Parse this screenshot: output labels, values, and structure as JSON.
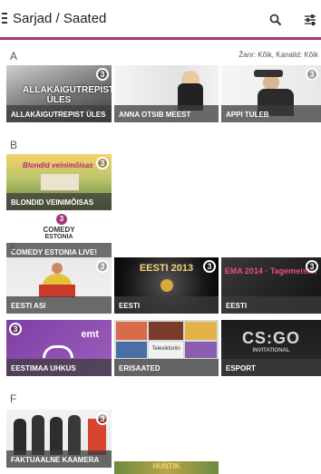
{
  "header": {
    "title": "Sarjad / Saated",
    "search_icon": "search-icon",
    "filter_icon": "filter-sliders-icon",
    "accent_color": "#a6357a"
  },
  "filters": {
    "text": "Žanr: Kõik, Kanalid: Kõik"
  },
  "sections": [
    {
      "letter": "A",
      "items": [
        {
          "label": "ALLAKÄIGUTREPIST ÜLES",
          "overlay": "ALLAKÄIGUTREPIST ÜLES",
          "badge": "3"
        },
        {
          "label": "ANNA OTSIB MEEST"
        },
        {
          "label": "APPI TULEB",
          "badge": "3"
        }
      ]
    },
    {
      "letter": "B",
      "items": [
        {
          "label": "BLONDID VEINIMÕISAS",
          "overlay": "Blondid veinimõisas",
          "badge": "3"
        },
        {
          "label": "COMEDY ESTONIA LIVE!",
          "logo_top": "3",
          "logo_main": "COMEDY",
          "logo_sub": "ESTONIA"
        }
      ]
    },
    {
      "letter": "E",
      "items": [
        {
          "label": "EESTI ASI",
          "badge": "3"
        },
        {
          "label": "EESTI",
          "overlay": "EESTI 2013",
          "badge": "3"
        },
        {
          "label": "EESTI",
          "overlay": "EMA 2014 · Tagemeister",
          "badge": "3"
        },
        {
          "label": "EESTIMAA UHKUS",
          "logo": "emt",
          "badge": "3"
        },
        {
          "label": "ERISAATED",
          "overlay": "Televiktoriin"
        },
        {
          "label": "ESPORT",
          "overlay": "CS:GO",
          "overlay_sub": "INVITATIONAL"
        }
      ]
    },
    {
      "letter": "F",
      "items": [
        {
          "label": "FAKTUAALNE KAAMERA",
          "badge": "3"
        },
        {
          "label": "",
          "overlay": "HUNTIK"
        }
      ]
    }
  ]
}
